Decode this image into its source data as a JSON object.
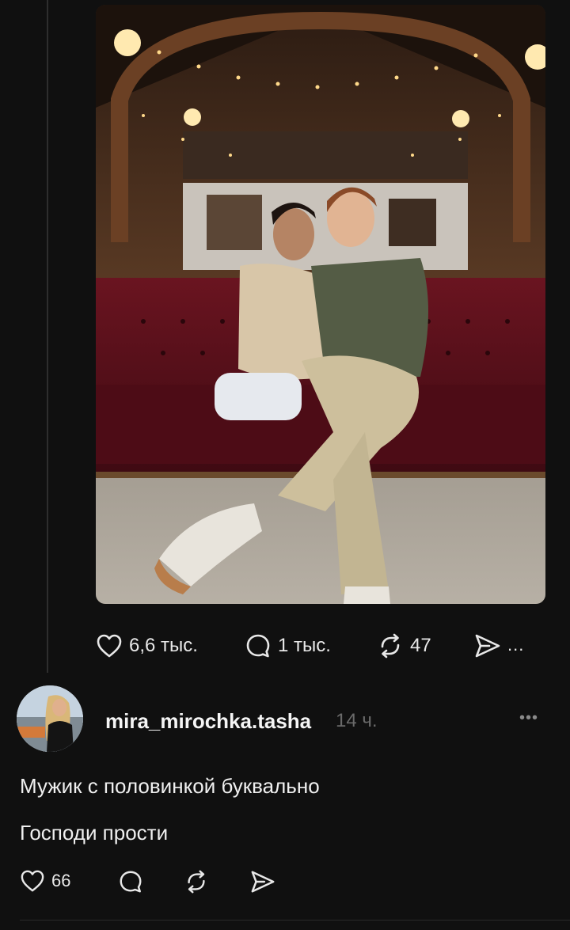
{
  "post": {
    "photo_alt": "photo",
    "stats": {
      "likes": "6,6 тыс.",
      "comments": "1 тыс.",
      "reposts": "47",
      "more": "..."
    }
  },
  "comment": {
    "username": "mira_mirochka.tasha",
    "time": "14 ч.",
    "menu": "•••",
    "lines": [
      "Мужик с половинкой буквально",
      "Господи прости"
    ],
    "likes": "66"
  },
  "icons": {
    "like": "heart-icon",
    "comment": "speech-bubble-icon",
    "repost": "repost-icon",
    "share": "send-icon"
  }
}
